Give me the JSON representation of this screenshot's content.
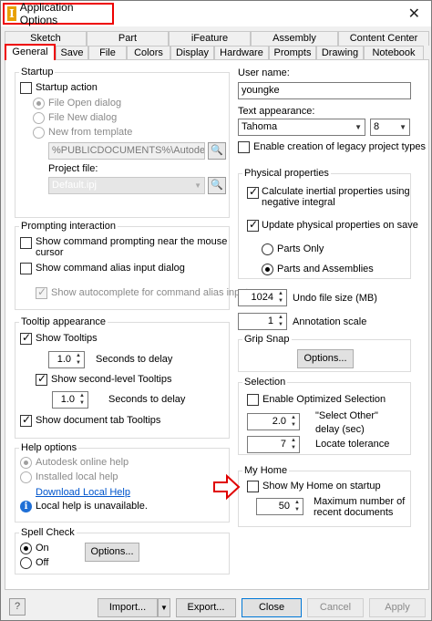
{
  "window": {
    "title": "Application Options",
    "close": "✕"
  },
  "tabs": {
    "row1": [
      "Sketch",
      "Part",
      "iFeature",
      "Assembly",
      "Content Center"
    ],
    "row2": [
      "General",
      "Save",
      "File",
      "Colors",
      "Display",
      "Hardware",
      "Prompts",
      "Drawing",
      "Notebook"
    ]
  },
  "startup": {
    "label": "Startup",
    "action": "Startup action",
    "open": "File Open dialog",
    "new": "File New dialog",
    "template": "New from template",
    "template_path": "%PUBLICDOCUMENTS%\\Autodesk\\Inve",
    "project_label": "Project file:",
    "project": "Default.ipj"
  },
  "prompting": {
    "label": "Prompting interaction",
    "near_mouse": "Show command prompting near the mouse",
    "near_mouse_2": "cursor",
    "alias": "Show command alias input dialog",
    "autocomplete": "Show autocomplete for command alias input"
  },
  "tooltip": {
    "label": "Tooltip appearance",
    "show": "Show Tooltips",
    "delay1": "1.0",
    "delay1_label": "Seconds to delay",
    "second": "Show second-level Tooltips",
    "delay2": "1.0",
    "delay2_label": "Seconds to delay",
    "doc_tab": "Show document tab Tooltips"
  },
  "help": {
    "label": "Help options",
    "online": "Autodesk online help",
    "local": "Installed local help",
    "download": "Download Local Help",
    "info_icon": "info-icon",
    "unavailable": "Local help is unavailable."
  },
  "spell": {
    "label": "Spell Check",
    "on": "On",
    "off": "Off",
    "options": "Options..."
  },
  "user": {
    "label": "User name:",
    "value": "youngke"
  },
  "text": {
    "label": "Text appearance:",
    "font": "Tahoma",
    "size": "8",
    "legacy": "Enable creation of legacy project types"
  },
  "physical": {
    "label": "Physical properties",
    "inertial": "Calculate inertial properties using",
    "inertial_2": "negative integral",
    "update": "Update physical properties on save",
    "parts": "Parts Only",
    "parts_asm": "Parts and Assemblies"
  },
  "undo": {
    "value": "1024",
    "label": "Undo file size (MB)"
  },
  "annotation": {
    "value": "1",
    "label": "Annotation scale"
  },
  "grip": {
    "label": "Grip Snap",
    "options": "Options..."
  },
  "selection": {
    "label": "Selection",
    "optimized": "Enable Optimized Selection",
    "delay": "2.0",
    "delay_label_1": "\"Select Other\"",
    "delay_label_2": "delay (sec)",
    "tolerance": "7",
    "tolerance_label": "Locate tolerance"
  },
  "myhome": {
    "label": "My Home",
    "show": "Show My Home on startup",
    "recent": "50",
    "recent_label_1": "Maximum number of",
    "recent_label_2": "recent documents"
  },
  "bottom": {
    "import": "Import...",
    "export": "Export...",
    "close": "Close",
    "cancel": "Cancel",
    "apply": "Apply"
  },
  "colors": {
    "highlight": "#e00000",
    "link": "#0055cc",
    "focus": "#0078d7"
  }
}
